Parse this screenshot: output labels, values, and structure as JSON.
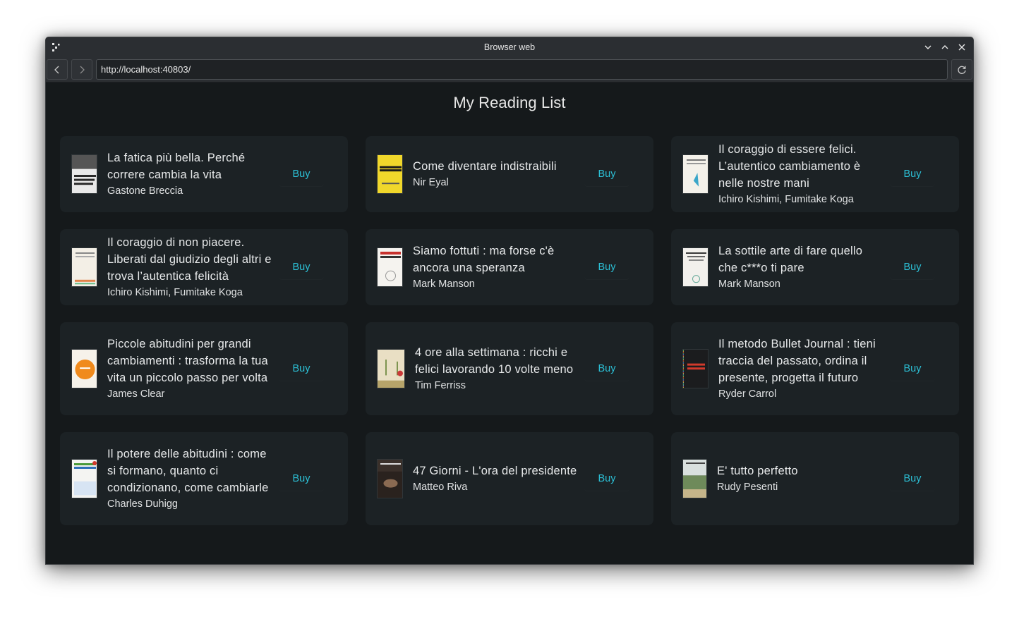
{
  "window": {
    "title": "Browser web"
  },
  "toolbar": {
    "url": "http://localhost:40803/"
  },
  "page": {
    "heading": "My Reading List",
    "buy_label": "Buy"
  },
  "books": [
    {
      "title": "La fatica più bella. Perché correre cambia la vita",
      "author": "Gastone Breccia"
    },
    {
      "title": "Come diventare indistraibili",
      "author": "Nir Eyal"
    },
    {
      "title": "Il coraggio di essere felici. L’autentico cambiamento è nelle nostre mani",
      "author": "Ichiro Kishimi, Fumitake Koga"
    },
    {
      "title": "Il coraggio di non piacere. Liberati dal giudizio degli altri e trova l’autentica felicità",
      "author": "Ichiro Kishimi, Fumitake Koga"
    },
    {
      "title": "Siamo fottuti : ma forse c'è ancora una speranza",
      "author": "Mark Manson"
    },
    {
      "title": "La sottile arte di fare quello che c***o ti pare",
      "author": "Mark Manson"
    },
    {
      "title": "Piccole abitudini per grandi cambiamenti : trasforma la tua vita un piccolo passo per volta",
      "author": "James Clear"
    },
    {
      "title": "4 ore alla settimana : ricchi e felici lavorando 10 volte meno",
      "author": "Tim Ferriss"
    },
    {
      "title": "Il metodo Bullet Journal : tieni traccia del passato, ordina il presente, progetta il futuro",
      "author": "Ryder Carrol"
    },
    {
      "title": "Il potere delle abitudini : come si formano, quanto ci condizionano, come cambiarle",
      "author": "Charles Duhigg"
    },
    {
      "title": "47 Giorni - L'ora del presidente",
      "author": "Matteo Riva"
    },
    {
      "title": "E' tutto perfetto",
      "author": "Rudy Pesenti"
    }
  ],
  "covers": [
    {
      "icon": "book-cover-bw",
      "bg": "#e9e9e9",
      "accent": "#2a2a2a",
      "lettering": "LA FATICA PIÙ BELLA"
    },
    {
      "icon": "book-cover-yellow",
      "bg": "#f0d72b",
      "accent": "#1a1a1a",
      "lettering": "Come diventare indistraibili"
    },
    {
      "icon": "book-cover-white-hummingbird",
      "bg": "#f4f1ea",
      "accent": "#3aa6c9",
      "lettering": "Il coraggio di essere felici"
    },
    {
      "icon": "book-cover-white-orange",
      "bg": "#f3efe6",
      "accent": "#e2834a",
      "lettering": "Il coraggio di non piacere"
    },
    {
      "icon": "book-cover-white-red",
      "bg": "#f5f3ef",
      "accent": "#c8322e",
      "lettering": "SIAMO FOTTUTI"
    },
    {
      "icon": "book-cover-white-small",
      "bg": "#f2f0ec",
      "accent": "#3a3a3a",
      "lettering": "La sottile arte"
    },
    {
      "icon": "book-cover-orange-sun",
      "bg": "#f6f2ea",
      "accent": "#f08a1c",
      "lettering": "Piccole abitudini"
    },
    {
      "icon": "book-cover-beige-palms",
      "bg": "#e9dfc4",
      "accent": "#5a7a2a",
      "lettering": "4 ore alla settimana"
    },
    {
      "icon": "book-cover-dark-dots",
      "bg": "#1b1c1e",
      "accent": "#d23a2c",
      "lettering": "IL METODO BULLET JOURNAL"
    },
    {
      "icon": "book-cover-white-blue",
      "bg": "#f4f4f2",
      "accent": "#2d6fb8",
      "lettering": "IL POTERE DELLE ABITUDINI"
    },
    {
      "icon": "book-cover-dark-photo",
      "bg": "#3a302a",
      "accent": "#8a6a52",
      "lettering": "47 GIORNI"
    },
    {
      "icon": "book-cover-landscape",
      "bg": "#a9b89a",
      "accent": "#6e8a5a",
      "lettering": "E' tutto perfetto"
    }
  ],
  "colors": {
    "accent": "#2cc0d6",
    "card_bg": "#1c2225",
    "page_bg": "#15191b"
  }
}
